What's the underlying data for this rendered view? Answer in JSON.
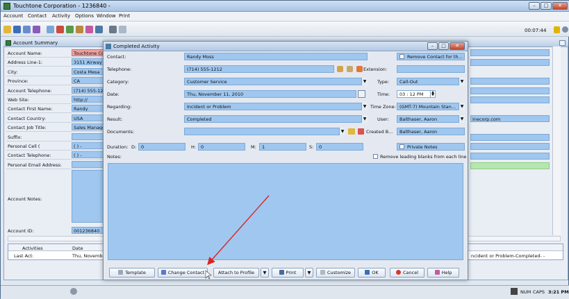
{
  "window": {
    "title": "Touchtone Corporation - 1236840 -",
    "controls": [
      "minimize",
      "maximize",
      "close"
    ]
  },
  "menu": [
    "Account",
    "Contact",
    "Activity",
    "Options",
    "Window",
    "Print"
  ],
  "toolbar": {
    "timer": "00:07:44"
  },
  "account_summary": {
    "title": "Account Summary",
    "fields": [
      {
        "label": "Account Name:",
        "value": "Touchtone Co",
        "style": "red"
      },
      {
        "label": "Address Line-1:",
        "value": "3151 Airway A"
      },
      {
        "label": "City:",
        "value": "Costa Mesa"
      },
      {
        "label": "Province:",
        "value": "CA"
      },
      {
        "label": "Account Telephone:",
        "value": "(714) 555-12"
      },
      {
        "label": "Web Site:",
        "value": "http://"
      },
      {
        "label": "Contact First Name:",
        "value": "Randy"
      },
      {
        "label": "Contact Country:",
        "value": "USA"
      },
      {
        "label": "Contact Job Title:",
        "value": "Sales Manage"
      },
      {
        "label": "Suffix:",
        "value": ""
      },
      {
        "label": "Personal Cell (",
        "value": "(  )  -"
      },
      {
        "label": "Contact Telephone:",
        "value": "(  )  -"
      },
      {
        "label": "Personal Email Address:",
        "value": ""
      }
    ],
    "notes_label": "Account Notes:",
    "account_id_label": "Account ID:",
    "account_id": "001236840",
    "right_email": "inecorp.com",
    "activities_header": {
      "col1": "Activities",
      "col2": "Date"
    },
    "last_act": {
      "label": "Last Act:",
      "date": "Thu, November",
      "desc": "ncident or Problem-Completed- -"
    }
  },
  "dialog": {
    "title": "Completed Activity",
    "contact_label": "Contact:",
    "contact": "Randy Moss",
    "remove_contact": "Remove Contact for th...",
    "telephone_label": "Telephone:",
    "telephone": "(714) 555-1212",
    "extension_label": "Extension:",
    "category_label": "Category:",
    "category": "Customer Service",
    "type_label": "Type:",
    "type": "Call-Out",
    "date_label": "Date:",
    "date": "Thu, November 11, 2010",
    "time_label": "Time:",
    "time": "03 : 12   PM",
    "regarding_label": "Regarding:",
    "regarding": "Incident or Problem",
    "timezone_label": "Time Zone:",
    "timezone": "(GMT-7) Mountain Stan...",
    "result_label": "Result:",
    "result": "Completed",
    "user_label": "User:",
    "user": "Balthaser, Aaron",
    "documents_label": "Documents:",
    "created_by_label": "Created B...",
    "created_by": "Balthaser, Aaron",
    "duration_label": "Duration:",
    "d_label": "D:",
    "d": "0",
    "h_label": "H:",
    "h": "0",
    "m_label": "M:",
    "m": "1",
    "s_label": "S:",
    "s": "0",
    "private_notes": "Private Notes",
    "notes_label": "Notes:",
    "remove_blanks": "Remove leading blanks from each line",
    "buttons": {
      "template": "Template",
      "change_contact": "Change Contact",
      "attach_profile": "Attach to Profile",
      "print": "Print",
      "customize": "Customize",
      "ok": "OK",
      "cancel": "Cancel",
      "help": "Help"
    }
  },
  "statusbar": {
    "num": "NUM",
    "caps": "CAPS",
    "time": "3:21 PM"
  }
}
